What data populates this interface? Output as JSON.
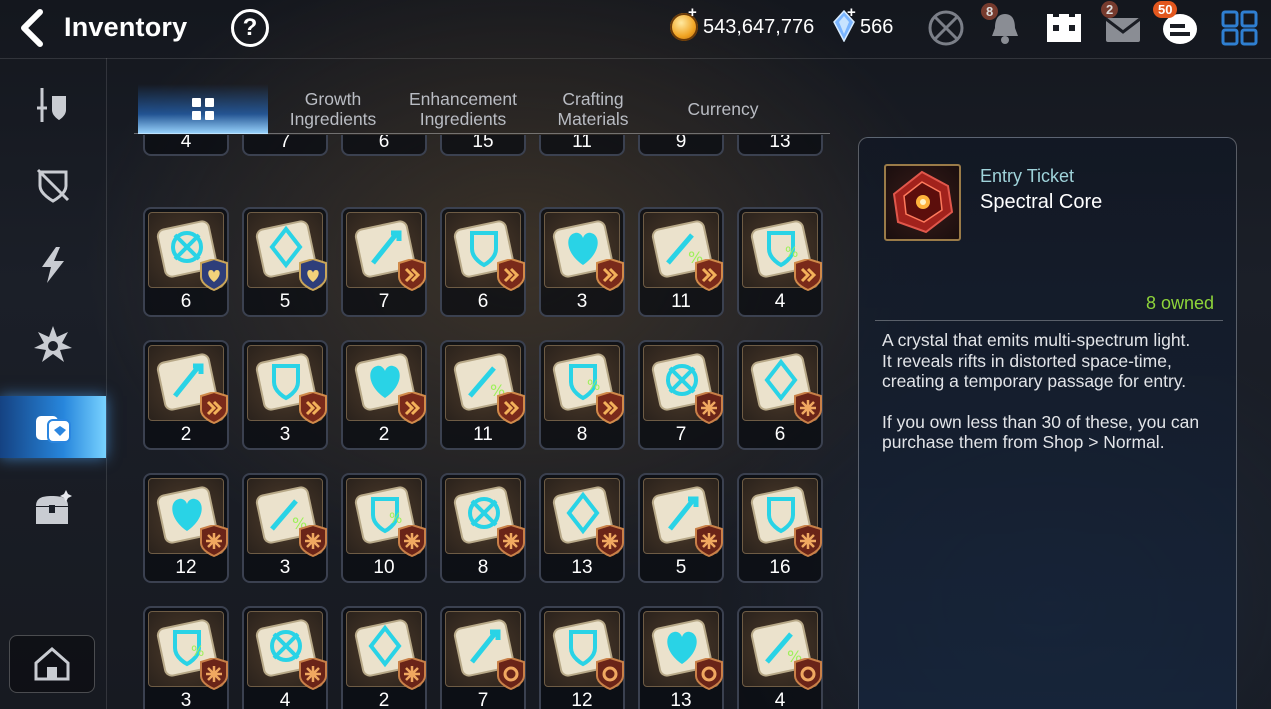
{
  "header": {
    "title": "Inventory",
    "help_glyph": "?",
    "gold": "543,647,776",
    "gems": "566",
    "notifications": "8",
    "mail": "2",
    "chat": "50"
  },
  "tabs": [
    {
      "label": "",
      "icon": "grid-icon",
      "active": true
    },
    {
      "label": "Growth Ingredients"
    },
    {
      "label": "Enhancement Ingredients"
    },
    {
      "label": "Crafting Materials"
    },
    {
      "label": "Currency"
    }
  ],
  "sidebar": [
    "equipment-icon",
    "artifact-icon",
    "skill-icon",
    "spirit-icon",
    "materials-icon",
    "chest-icon"
  ],
  "grid": {
    "top_row": [
      "4",
      "7",
      "6",
      "15",
      "11",
      "9",
      "13"
    ],
    "rows": [
      [
        "6",
        "5",
        "7",
        "6",
        "3",
        "11",
        "4"
      ],
      [
        "2",
        "3",
        "2",
        "11",
        "8",
        "7",
        "6"
      ],
      [
        "12",
        "3",
        "10",
        "8",
        "13",
        "5",
        "16"
      ],
      [
        "3",
        "4",
        "2",
        "7",
        "12",
        "13",
        "4"
      ]
    ]
  },
  "detail": {
    "category": "Entry Ticket",
    "name": "Spectral Core",
    "owned": "8 owned",
    "desc1": "A crystal that emits multi-spectrum light.",
    "desc2": "It reveals rifts in distorted space-time, creating a temporary passage for entry.",
    "desc3": "If you own less than 30 of these, you can purchase them from Shop > Normal."
  },
  "colors": {
    "owned": "#8ed43a",
    "accent": "#3aa3ff",
    "rune": "#29d3e6"
  }
}
